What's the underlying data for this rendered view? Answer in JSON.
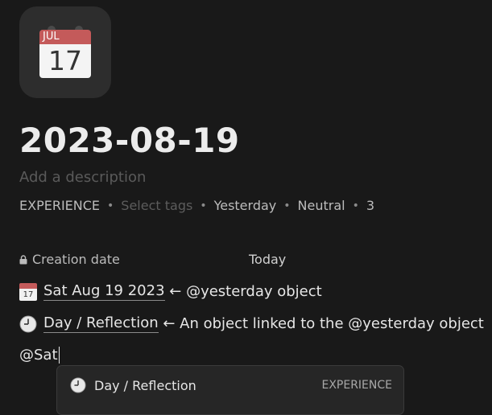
{
  "icon": {
    "name": "calendar-icon",
    "month": "JUL",
    "day": "17"
  },
  "title": "2023-08-19",
  "description_placeholder": "Add a description",
  "meta": {
    "type": "EXPERIENCE",
    "tags_placeholder": "Select tags",
    "day": "Yesterday",
    "mood": "Neutral",
    "count": "3"
  },
  "property": {
    "label": "Creation date",
    "value": "Today"
  },
  "lines": [
    {
      "icon": "calendar-icon",
      "icon_day": "17",
      "link": "Sat Aug 19 2023",
      "text": " ← @yesterday object"
    },
    {
      "icon": "clock-icon",
      "link": "Day / Reflection",
      "text": " ← An object linked to the @yesterday object"
    }
  ],
  "typing": "@Sat",
  "popup": {
    "item_label": "Day / Reflection",
    "item_type": "EXPERIENCE"
  },
  "colors": {
    "background": "#191919",
    "accent_red": "#c45a5a"
  }
}
